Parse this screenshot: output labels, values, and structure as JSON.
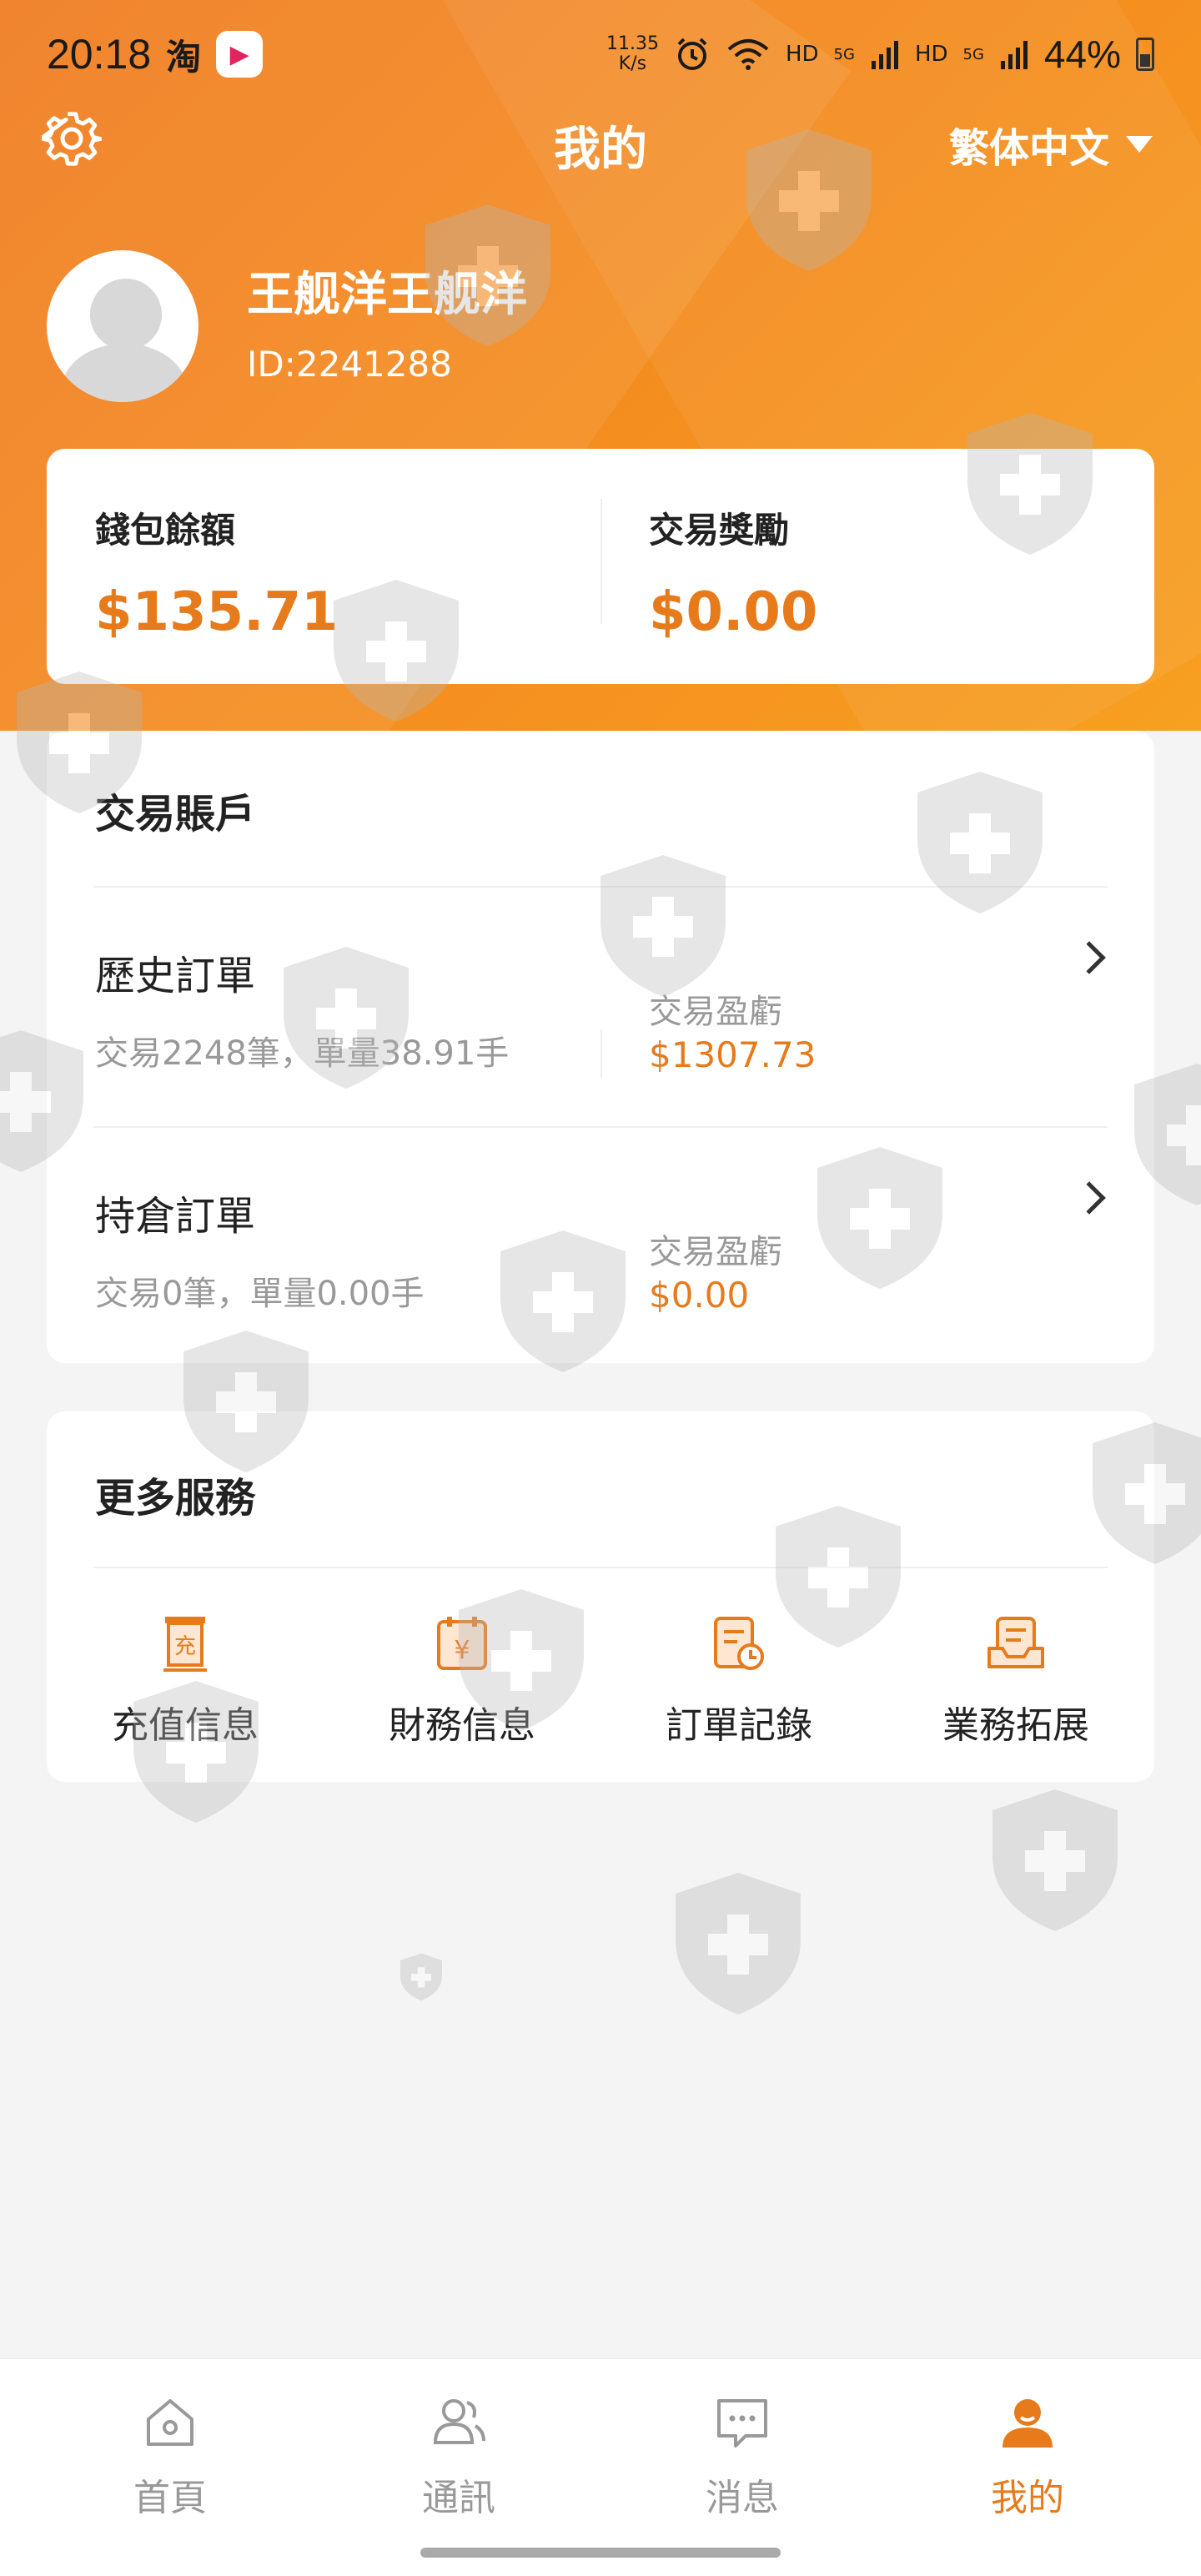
{
  "status_bar": {
    "time": "20:18",
    "taobao": "淘",
    "speed_value": "11.35",
    "speed_unit": "K/s",
    "hd1": "HD",
    "hd2": "HD",
    "sig1": "5G",
    "sig2": "5G",
    "battery": "44%"
  },
  "header": {
    "title": "我的",
    "language": "繁体中文"
  },
  "profile": {
    "name": "王舰洋王舰洋",
    "id": "ID:2241288"
  },
  "balance": {
    "wallet_label": "錢包餘額",
    "wallet_value": "$135.71",
    "reward_label": "交易獎勵",
    "reward_value": "$0.00"
  },
  "trading_account": {
    "title": "交易賬戶",
    "rows": [
      {
        "title": "歷史訂單",
        "subtitle": "交易2248筆，單量38.91手",
        "pl_label": "交易盈虧",
        "pl_value": "$1307.73"
      },
      {
        "title": "持倉訂單",
        "subtitle": "交易0筆，單量0.00手",
        "pl_label": "交易盈虧",
        "pl_value": "$0.00"
      }
    ]
  },
  "services": {
    "title": "更多服務",
    "items": [
      {
        "label": "充值信息",
        "icon": "recharge-icon",
        "glyph": "充"
      },
      {
        "label": "財務信息",
        "icon": "finance-icon",
        "glyph": "¥"
      },
      {
        "label": "訂單記錄",
        "icon": "order-record-icon"
      },
      {
        "label": "業務拓展",
        "icon": "business-icon"
      }
    ]
  },
  "tabs": [
    {
      "label": "首頁",
      "icon": "home-icon"
    },
    {
      "label": "通訊",
      "icon": "contacts-icon"
    },
    {
      "label": "消息",
      "icon": "message-icon"
    },
    {
      "label": "我的",
      "icon": "profile-icon",
      "active": true
    }
  ],
  "colors": {
    "accent": "#e77b1b",
    "header_start": "#ef7a1e",
    "header_end": "#f7a021"
  }
}
